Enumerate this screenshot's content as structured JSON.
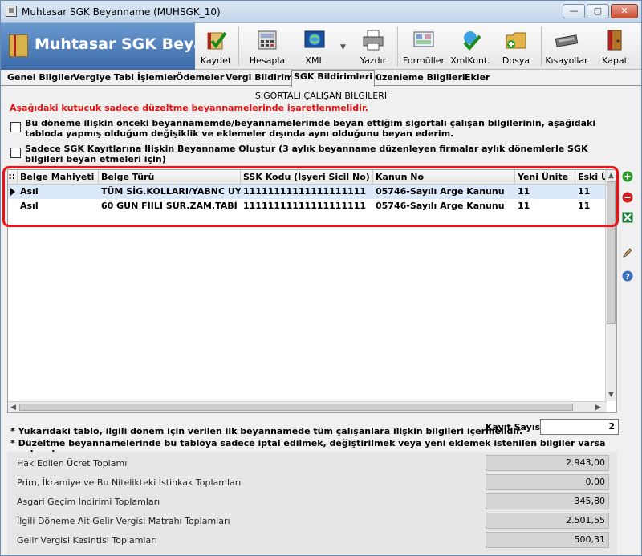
{
  "window": {
    "title": "Muhtasar SGK  Beyanname (MUHSGK_10)",
    "minimize": "—",
    "maximize": "▢",
    "close": "✕"
  },
  "toolbar": {
    "brand": "Muhtasar SGK  Beyan",
    "buttons": [
      {
        "label": "Kaydet",
        "icon": "save-check-icon"
      },
      {
        "label": "Hesapla",
        "icon": "calculator-icon"
      },
      {
        "label": "XML",
        "icon": "xml-globe-icon"
      },
      {
        "label": "Yazdır",
        "icon": "printer-icon"
      },
      {
        "label": "Formüller",
        "icon": "formulas-icon"
      },
      {
        "label": "XmlKont.",
        "icon": "xml-check-icon"
      },
      {
        "label": "Dosya",
        "icon": "file-folder-icon"
      },
      {
        "label": "Kısayollar",
        "icon": "keyboard-icon"
      },
      {
        "label": "Kapat",
        "icon": "exit-door-icon"
      }
    ]
  },
  "tabs": [
    {
      "label": "Genel Bilgiler"
    },
    {
      "label": "Vergiye Tabi İşlemler"
    },
    {
      "label": "Ödemeler"
    },
    {
      "label": "Vergi Bildirimi"
    },
    {
      "label": "SGK Bildirimleri"
    },
    {
      "label": "Düzenleme Bilgileri"
    },
    {
      "label": "Ekler"
    }
  ],
  "section": {
    "title": "SİGORTALI ÇALIŞAN BİLGİLERİ",
    "warning": "Aşağıdaki kutucuk sadece düzeltme beyannamelerinde işaretlenmelidir.",
    "checkbox1": "Bu döneme ilişkin önceki beyannamemde/beyannamelerimde beyan ettiğim sigortalı çalışan bilgilerinin, aşağıdaki tabloda yapmış olduğum değişiklik ve eklemeler dışında aynı olduğunu beyan ederim.",
    "checkbox2": "Sadece SGK Kayıtlarına İlişkin Beyanname Oluştur (3 aylık beyanname düzenleyen firmalar aylık dönemlerle SGK bilgileri beyan etmeleri için)"
  },
  "grid": {
    "columns": [
      "Belge Mahiyeti",
      "Belge Türü",
      "SSK Kodu (İşyeri Sicil No)",
      "Kanun No",
      "Yeni Ünite",
      "Eski Ü"
    ],
    "rows": [
      [
        "Asıl",
        "TÜM SİG.KOLLARI/YABNC UYR",
        "11111111111111111111",
        "05746-Sayılı Arge Kanunu",
        "11",
        "11"
      ],
      [
        "Asıl",
        "60 GUN FİİLİ SÜR.ZAM.TABİ",
        "11111111111111111111",
        "05746-Sayılı Arge Kanunu",
        "11",
        "11"
      ]
    ]
  },
  "notes": {
    "note1": "* Yukarıdaki tablo, ilgili dönem için verilen ilk beyannamede tüm çalışanlara ilişkin bilgileri içermelidir.",
    "note2": "* Düzeltme beyannamelerinde bu tabloya sadece iptal edilmek, değiştirilmek veya yeni eklemek istenilen bilgiler varsa yazılmadır.",
    "kayit_label": "Kayıt Sayısı",
    "kayit_value": "2"
  },
  "summary": [
    {
      "label": "Hak Edilen Ücret Toplamı",
      "value": "2.943,00"
    },
    {
      "label": "Prim, İkramiye ve Bu Nitelikteki İstihkak Toplamları",
      "value": "0,00"
    },
    {
      "label": "Asgari Geçim İndirimi Toplamları",
      "value": "345,80"
    },
    {
      "label": "İlgili Döneme Ait Gelir Vergisi Matrahı Toplamları",
      "value": "2.501,55"
    },
    {
      "label": "Gelir Vergisi Kesintisi Toplamları",
      "value": "500,31"
    }
  ],
  "colors": {
    "accent": "#3c6aa9",
    "warning": "#dd1111",
    "highlight": "#ee1111",
    "selected_row": "#dce9fb"
  }
}
